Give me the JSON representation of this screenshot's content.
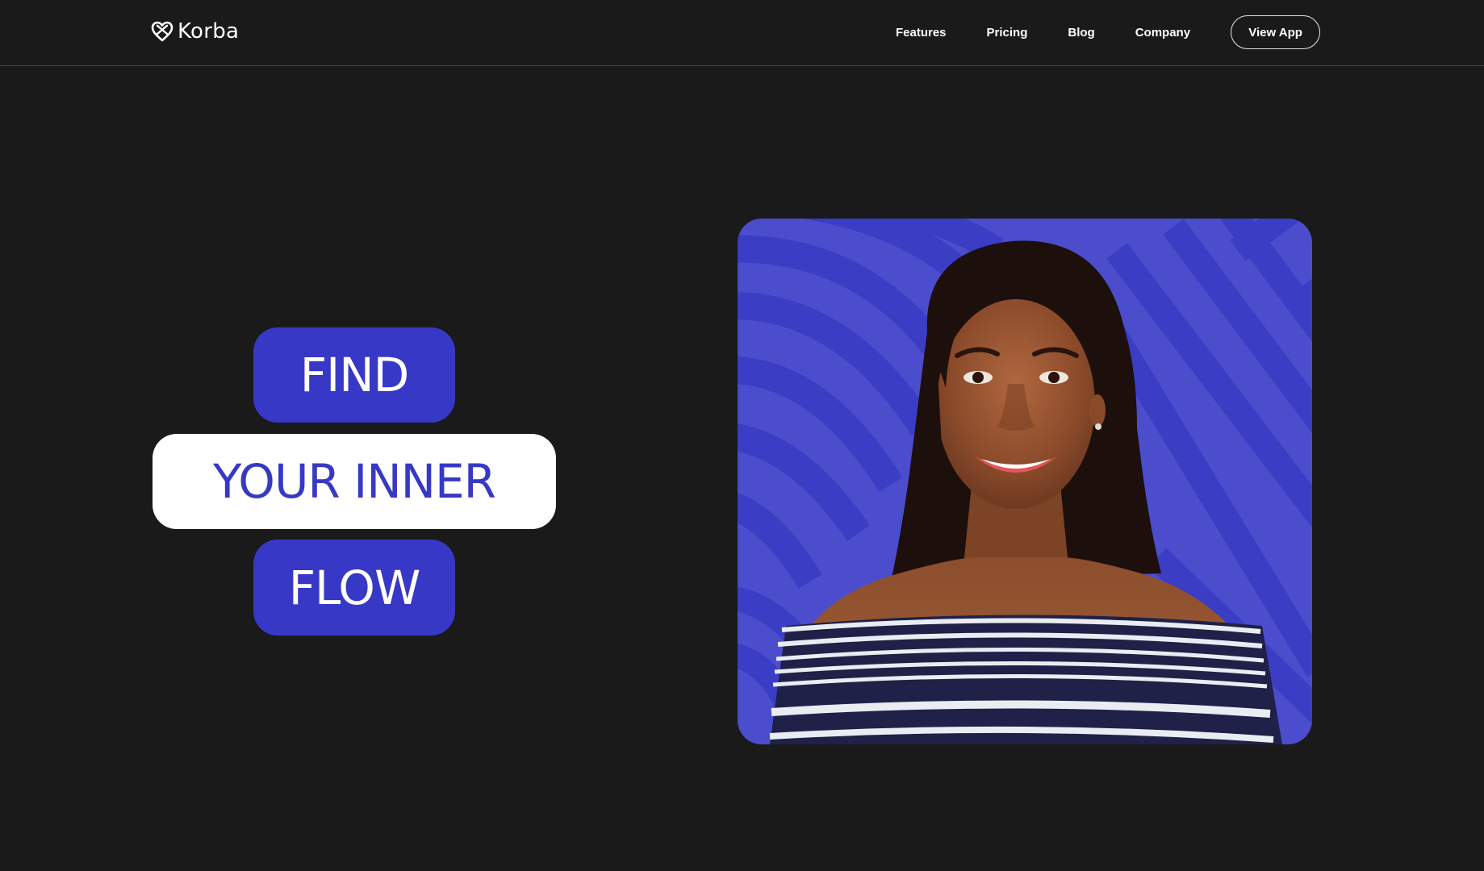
{
  "brand": {
    "name": "Korba"
  },
  "nav": {
    "links": [
      "Features",
      "Pricing",
      "Blog",
      "Company"
    ],
    "cta_label": "View App"
  },
  "hero": {
    "lines": [
      "FIND",
      "YOUR INNER",
      "FLOW"
    ],
    "image_alt": "Smiling woman in striped off-shoulder top on blue patterned background"
  },
  "colors": {
    "background": "#1a1a1a",
    "accent": "#3838c6",
    "pill_light": "#ffffff",
    "photo_bg": "#4b4dcc",
    "photo_pattern": "#3a3cc4"
  }
}
